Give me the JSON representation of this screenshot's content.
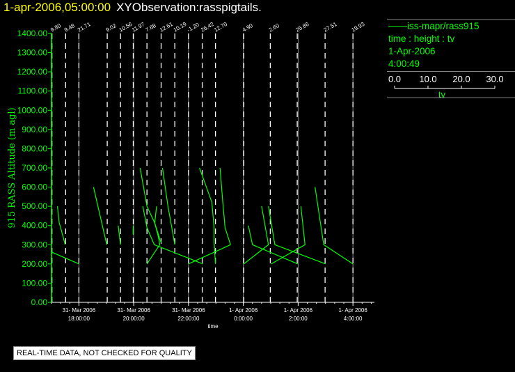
{
  "header": {
    "datetime": "1-apr-2006,05:00:00",
    "title": "XYObservation:rasspigtails."
  },
  "legend": {
    "series": "iss-mapr/rass915",
    "fields": "time : height : tv",
    "date": "1-Apr-2006",
    "time": "4:00:49",
    "scale_ticks": [
      "0.0",
      "10.0",
      "20.0",
      "30.0"
    ],
    "scale_label": "tv"
  },
  "notice": "REAL-TIME DATA, NOT CHECKED FOR QUALITY",
  "colors": {
    "trace": "#00ff00",
    "axis_y": "#00ff00",
    "axis_x": "#ffffff",
    "profile_marker": "#ffffff",
    "major_grid": "#888888",
    "header_date": "#ffff00"
  },
  "chart_data": {
    "type": "line",
    "ylabel": "915 RASS Altitude (m agl)",
    "xlabel": "time",
    "ylim": [
      0,
      1400
    ],
    "xlim": [
      "2006-03-31T17:00",
      "2006-04-01T04:47"
    ],
    "y_ticks": [
      "0.00",
      "100.00",
      "200.00",
      "300.00",
      "400.00",
      "500.00",
      "600.00",
      "700.00",
      "800.00",
      "900.00",
      "1000.00",
      "1100.00",
      "1200.00",
      "1300.00",
      "1400.00"
    ],
    "x_ticks": [
      {
        "t": "2006-03-31T18:00",
        "l1": "31- Mar 2006",
        "l2": "18:00:00"
      },
      {
        "t": "2006-03-31T20:00",
        "l1": "31- Mar 2006",
        "l2": "20:00:00"
      },
      {
        "t": "2006-03-31T22:00",
        "l1": "31- Mar 2006",
        "l2": "22:00:00"
      },
      {
        "t": "2006-04-01T00:00",
        "l1": "1- Apr 2006",
        "l2": "0:00:00"
      },
      {
        "t": "2006-04-01T02:00",
        "l1": "1- Apr 2006",
        "l2": "2:00:00"
      },
      {
        "t": "2006-04-01T04:00",
        "l1": "1- Apr 2006",
        "l2": "4:00:00"
      }
    ],
    "profiles": [
      {
        "t": "2006-03-31T17:01",
        "label": "9.80"
      },
      {
        "t": "2006-03-31T17:31",
        "label": "9.48"
      },
      {
        "t": "2006-03-31T18:00",
        "label": "21.71"
      },
      {
        "t": "2006-03-31T19:02",
        "label": "9.02"
      },
      {
        "t": "2006-03-31T19:31",
        "label": "10.56"
      },
      {
        "t": "2006-03-31T19:59",
        "label": "11.97"
      },
      {
        "t": "2006-03-31T20:29",
        "label": "7.68"
      },
      {
        "t": "2006-03-31T21:00",
        "label": "12.61"
      },
      {
        "t": "2006-03-31T21:30",
        "label": "10.19"
      },
      {
        "t": "2006-03-31T22:00",
        "label": "-1.20"
      },
      {
        "t": "2006-03-31T22:30",
        "label": "26.42"
      },
      {
        "t": "2006-03-31T22:59",
        "label": "12.70"
      },
      {
        "t": "2006-04-01T00:01",
        "label": "4.90"
      },
      {
        "t": "2006-04-01T00:59",
        "label": "2.60"
      },
      {
        "t": "2006-04-01T01:58",
        "label": "25.86"
      },
      {
        "t": "2006-04-01T02:59",
        "label": "27.51"
      },
      {
        "t": "2006-04-01T04:00",
        "label": "19.93"
      }
    ],
    "traces": [
      [
        [
          "2006-03-31T17:13",
          500
        ],
        [
          "2006-03-31T17:17",
          413
        ],
        [
          "2006-03-31T17:20",
          389
        ],
        [
          "2006-03-31T17:30",
          300
        ]
      ],
      [
        [
          "2006-03-31T17:01",
          261
        ],
        [
          "2006-03-31T18:00",
          200
        ]
      ],
      [
        [
          "2006-03-31T18:32",
          600
        ],
        [
          "2006-03-31T19:01",
          300
        ]
      ],
      [
        [
          "2006-03-31T19:26",
          400
        ],
        [
          "2006-03-31T19:31",
          300
        ]
      ],
      [
        [
          "2006-03-31T19:59",
          400
        ],
        [
          "2006-03-31T19:59",
          352
        ]
      ],
      [
        [
          "2006-03-31T20:14",
          700
        ],
        [
          "2006-03-31T20:29",
          500
        ],
        [
          "2006-03-31T20:46",
          413
        ],
        [
          "2006-03-31T20:58",
          323
        ],
        [
          "2006-03-31T21:00",
          312
        ]
      ],
      [
        [
          "2006-03-31T20:20",
          500
        ],
        [
          "2006-03-31T20:29",
          389
        ],
        [
          "2006-03-31T20:45",
          300
        ],
        [
          "2006-03-31T22:00",
          230
        ],
        [
          "2006-03-31T22:31",
          200
        ]
      ],
      [
        [
          "2006-03-31T20:50",
          500
        ],
        [
          "2006-03-31T20:46",
          413
        ],
        [
          "2006-03-31T20:54",
          341
        ],
        [
          "2006-03-31T20:57",
          300
        ],
        [
          "2006-03-31T20:29",
          200
        ]
      ],
      [
        [
          "2006-03-31T21:03",
          700
        ],
        [
          "2006-03-31T21:15",
          500
        ],
        [
          "2006-03-31T21:30",
          300
        ]
      ],
      [
        [
          "2006-03-31T22:24",
          700
        ],
        [
          "2006-03-31T22:51",
          522
        ],
        [
          "2006-03-31T22:56",
          389
        ],
        [
          "2006-03-31T22:56",
          312
        ],
        [
          "2006-03-31T22:59",
          200
        ]
      ],
      [
        [
          "2006-03-31T22:00",
          200
        ],
        [
          "2006-03-31T23:32",
          300
        ]
      ],
      [
        [
          "2006-03-31T23:09",
          700
        ],
        [
          "2006-03-31T23:15",
          522
        ],
        [
          "2006-03-31T23:20",
          389
        ],
        [
          "2006-03-31T23:32",
          300
        ]
      ],
      [
        [
          "2006-04-01T00:11",
          400
        ],
        [
          "2006-04-01T00:20",
          300
        ],
        [
          "2006-04-01T01:59",
          200
        ]
      ],
      [
        [
          "2006-04-01T00:01",
          200
        ],
        [
          "2006-04-01T00:55",
          300
        ],
        [
          "2006-04-01T00:40",
          500
        ]
      ],
      [
        [
          "2006-04-01T00:55",
          500
        ],
        [
          "2006-04-01T01:09",
          300
        ],
        [
          "2006-04-01T03:00",
          200
        ]
      ],
      [
        [
          "2006-04-01T01:01",
          200
        ],
        [
          "2006-04-01T02:15",
          300
        ],
        [
          "2006-04-01T02:06",
          500
        ]
      ],
      [
        [
          "2006-04-01T02:37",
          600
        ],
        [
          "2006-04-01T02:56",
          300
        ],
        [
          "2006-04-01T04:00",
          200
        ]
      ]
    ]
  }
}
